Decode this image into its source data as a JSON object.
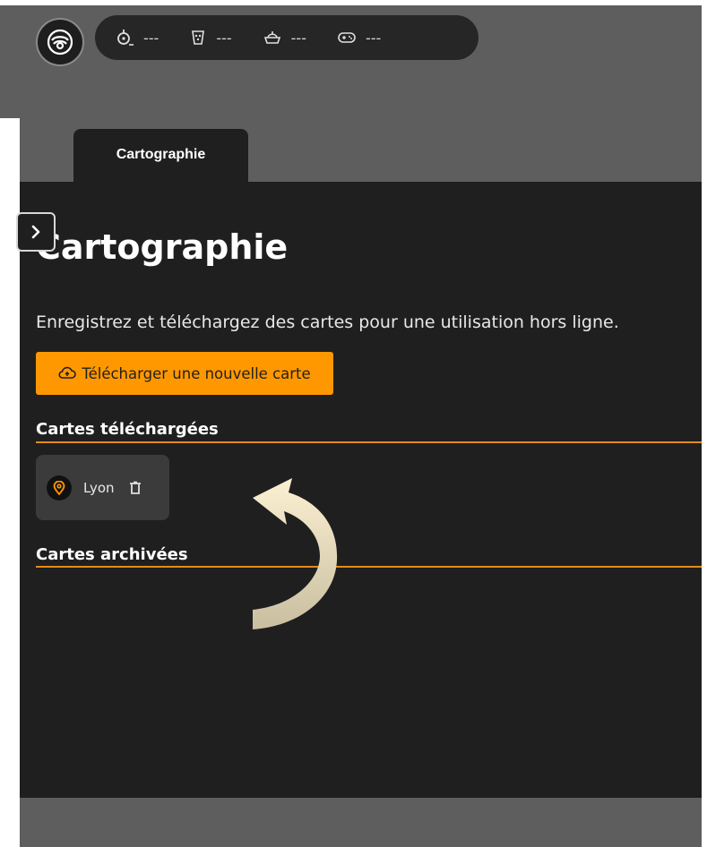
{
  "status_bar": {
    "items": [
      {
        "icon": "robot-position-icon",
        "value": "---"
      },
      {
        "icon": "cleaning-brush-icon",
        "value": "---"
      },
      {
        "icon": "vehicle-icon",
        "value": "---"
      },
      {
        "icon": "gamepad-icon",
        "value": "---"
      }
    ]
  },
  "tabs": [
    {
      "label": "Cartographie",
      "active": true
    }
  ],
  "main": {
    "title": "Cartographie",
    "subtitle": "Enregistrez et téléchargez des cartes pour une utilisation hors ligne.",
    "upload_button_label": "Télécharger une nouvelle carte",
    "downloaded_section_title": "Cartes téléchargées",
    "archived_section_title": "Cartes archivées",
    "downloaded_maps": [
      {
        "name": "Lyon",
        "icon": "map-pin-icon"
      }
    ]
  },
  "colors": {
    "accent": "#ff9800",
    "panel": "#1f1f1f",
    "frame": "#5e5e5e",
    "arrow": "#f5e7c4"
  }
}
